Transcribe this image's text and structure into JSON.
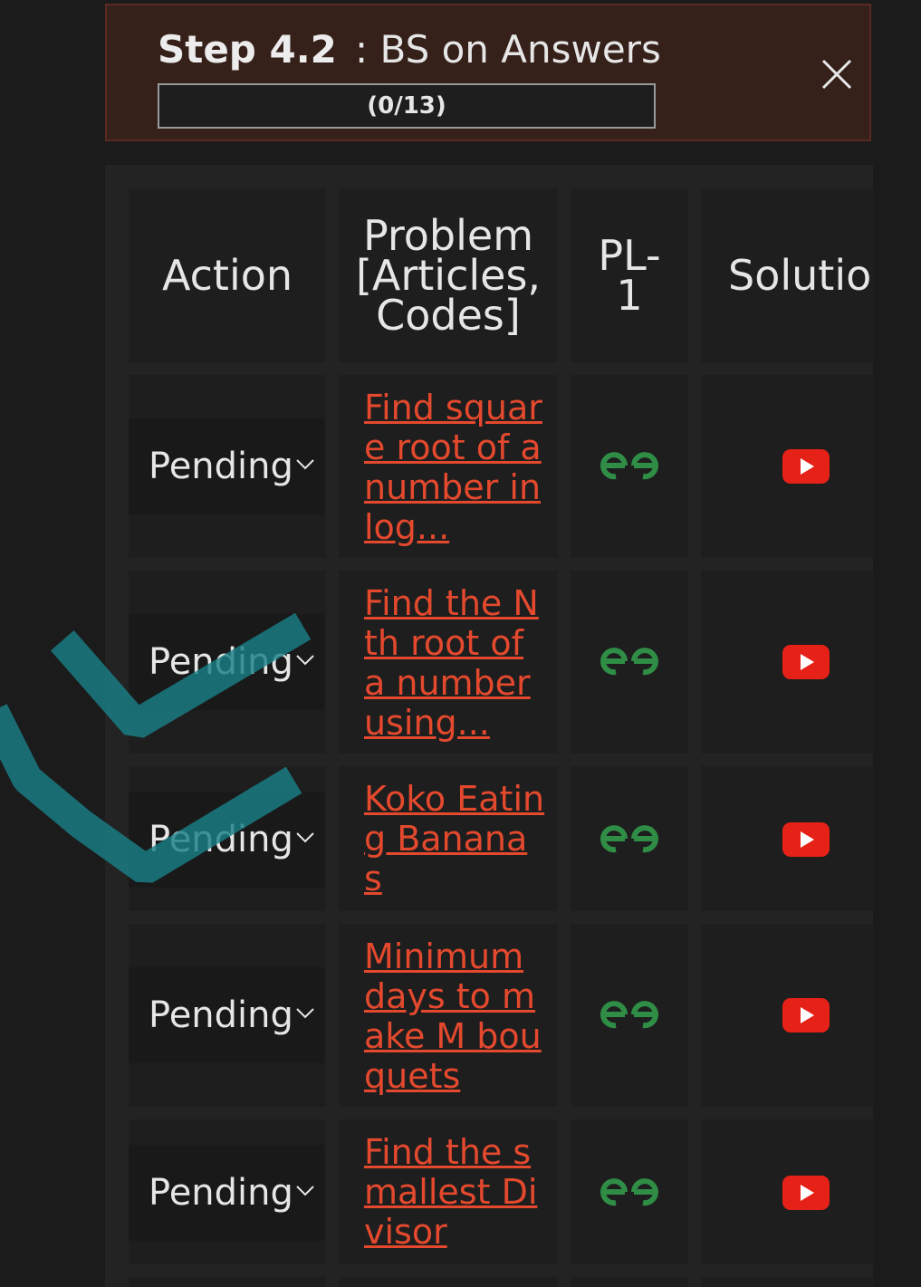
{
  "step": {
    "title": "Step 4.2",
    "subtitle": ": BS on Answers",
    "progress": "(0/13)"
  },
  "table": {
    "headers": {
      "action": "Action",
      "problem": "Problem [Articles, Codes]",
      "pl": "PL-1",
      "solution": "Solution"
    },
    "rows": [
      {
        "status": "Pending",
        "problem": "Find square root of a number in log..."
      },
      {
        "status": "Pending",
        "problem": "Find the Nth root of a number using..."
      },
      {
        "status": "Pending",
        "problem": "Koko Eating Bananas"
      },
      {
        "status": "Pending",
        "problem": "Minimum days to make M bouquets"
      },
      {
        "status": "Pending",
        "problem": "Find the smallest Divisor"
      }
    ]
  },
  "colors": {
    "link": "#e4492e",
    "gfg": "#2f8d46",
    "youtube": "#e62117",
    "stroke": "#1a7f86"
  },
  "icons": {
    "close": "close-icon",
    "chevron": "chevron-down-icon",
    "gfg": "gfg-icon",
    "youtube": "youtube-icon"
  }
}
